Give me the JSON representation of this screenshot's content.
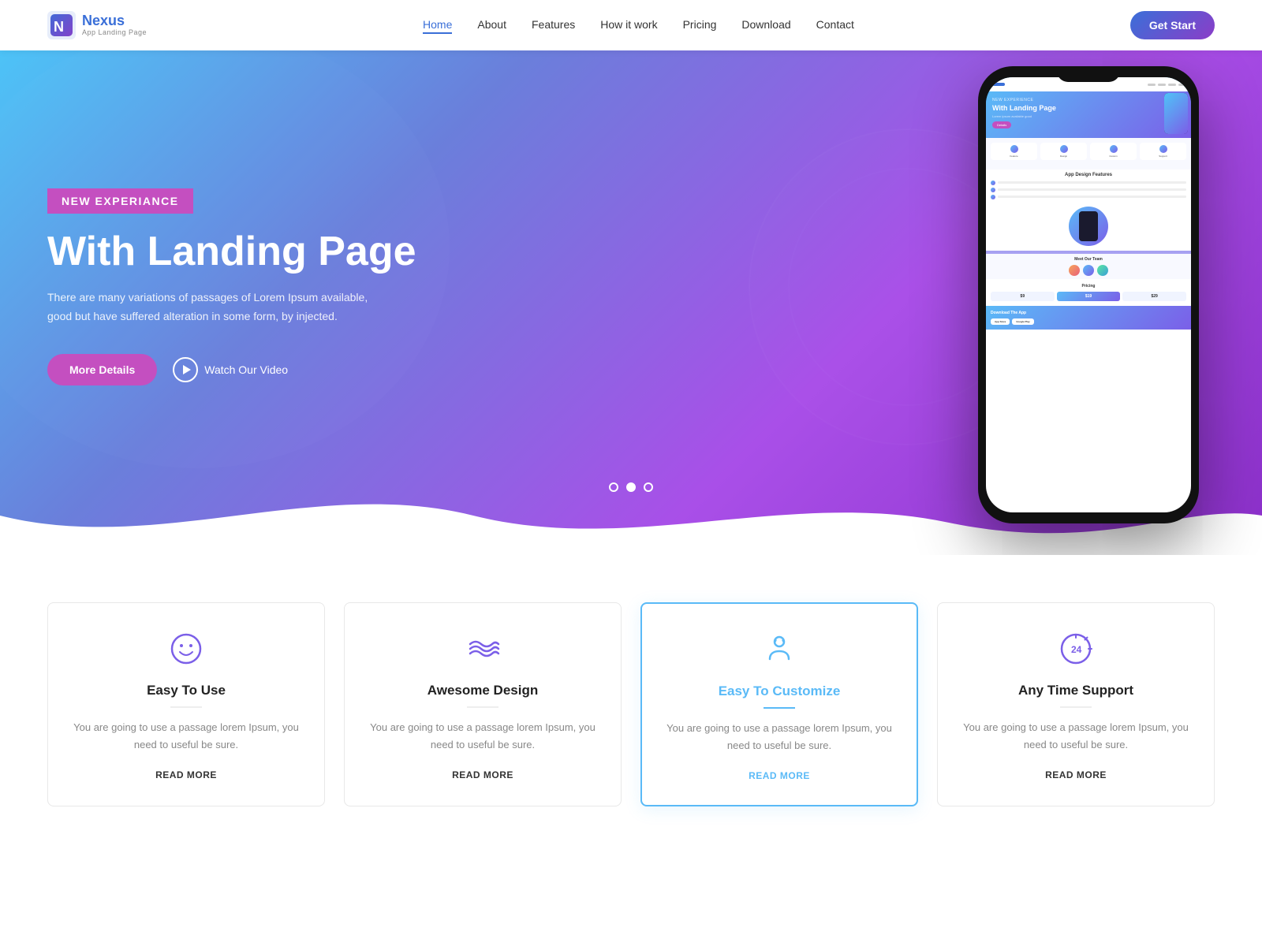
{
  "navbar": {
    "logo_name": "Nexus",
    "logo_sub": "App Landing Page",
    "nav_items": [
      {
        "label": "Home",
        "active": true
      },
      {
        "label": "About",
        "active": false
      },
      {
        "label": "Features",
        "active": false
      },
      {
        "label": "How it work",
        "active": false
      },
      {
        "label": "Pricing",
        "active": false
      },
      {
        "label": "Download",
        "active": false
      },
      {
        "label": "Contact",
        "active": false
      }
    ],
    "cta_label": "Get Start"
  },
  "hero": {
    "badge": "NEW EXPERIANCE",
    "title": "With Landing Page",
    "description": "There are many variations of passages of Lorem Ipsum available, good but have suffered alteration in some form, by injected.",
    "btn_more": "More Details",
    "btn_video": "Watch Our Video"
  },
  "features": {
    "cards": [
      {
        "icon": "smiley",
        "title": "Easy To Use",
        "description": "You are going to use a passage lorem Ipsum, you need to useful be sure.",
        "read_more": "READ MORE",
        "highlighted": false
      },
      {
        "icon": "waves",
        "title": "Awesome Design",
        "description": "You are going to use a passage lorem Ipsum, you need to useful be sure.",
        "read_more": "READ MORE",
        "highlighted": false
      },
      {
        "icon": "customize",
        "title": "Easy To Customize",
        "description": "You are going to use a passage lorem Ipsum, you need to useful be sure.",
        "read_more": "READ MORE",
        "highlighted": true
      },
      {
        "icon": "support",
        "title": "Any Time Support",
        "description": "You are going to use a passage lorem Ipsum, you need to useful be sure.",
        "read_more": "READ MORE",
        "highlighted": false
      }
    ]
  }
}
